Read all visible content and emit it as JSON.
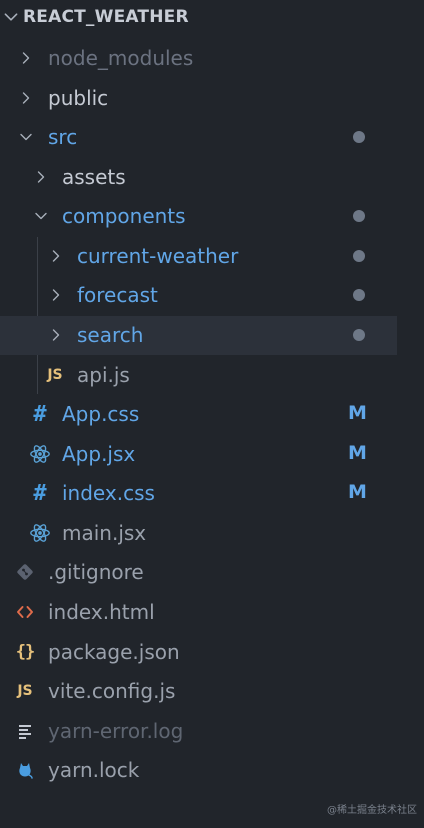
{
  "explorer": {
    "title": "REACT_WEATHER",
    "colors": {
      "background": "#21252b",
      "selected_row": "#2c313a",
      "text_default": "#c5cad3",
      "text_dimmed": "#6b7280",
      "text_modified": "#61a6e7",
      "modified_badge": "#61a6e7",
      "dot": "#6e7887",
      "chevron": "#a9b0bb",
      "js_icon": "#e5c07b",
      "css_icon": "#4a9de0",
      "react_icon": "#5aa2d6",
      "git_icon": "#5b6270",
      "html_icon": "#e06c4b",
      "json_icon": "#e5c07b",
      "log_icon": "#c5cad3",
      "yarn_icon": "#4a9de0"
    },
    "items": [
      {
        "label": "node_modules",
        "icon": "chevron-right-icon",
        "kind": "folder",
        "state": "collapsed",
        "dimmed": true
      },
      {
        "label": "public",
        "icon": "chevron-right-icon",
        "kind": "folder",
        "state": "collapsed"
      },
      {
        "label": "src",
        "icon": "chevron-down-icon",
        "kind": "folder",
        "state": "expanded",
        "modified": true,
        "has_dot": true
      },
      {
        "label": "assets",
        "icon": "chevron-right-icon",
        "kind": "folder",
        "state": "collapsed"
      },
      {
        "label": "components",
        "icon": "chevron-down-icon",
        "kind": "folder",
        "state": "expanded",
        "modified": true,
        "has_dot": true
      },
      {
        "label": "current-weather",
        "icon": "chevron-right-icon",
        "kind": "folder",
        "state": "collapsed",
        "modified": true,
        "has_dot": true
      },
      {
        "label": "forecast",
        "icon": "chevron-right-icon",
        "kind": "folder",
        "state": "collapsed",
        "modified": true,
        "has_dot": true
      },
      {
        "label": "search",
        "icon": "chevron-right-icon",
        "kind": "folder",
        "state": "collapsed",
        "modified": true,
        "has_dot": true,
        "selected": true
      },
      {
        "label": "api.js",
        "icon": "js-file-icon",
        "icon_text": "JS",
        "kind": "file"
      },
      {
        "label": "App.css",
        "icon": "css-hash-icon",
        "icon_text": "#",
        "kind": "file",
        "modified": true,
        "badge": "M"
      },
      {
        "label": "App.jsx",
        "icon": "react-atom-icon",
        "kind": "file",
        "modified": true,
        "badge": "M"
      },
      {
        "label": "index.css",
        "icon": "css-hash-icon",
        "icon_text": "#",
        "kind": "file",
        "modified": true,
        "badge": "M"
      },
      {
        "label": "main.jsx",
        "icon": "react-atom-icon",
        "kind": "file"
      },
      {
        "label": ".gitignore",
        "icon": "git-diamond-icon",
        "kind": "file"
      },
      {
        "label": "index.html",
        "icon": "html-code-icon",
        "kind": "file"
      },
      {
        "label": "package.json",
        "icon": "json-braces-icon",
        "icon_text": "{}",
        "kind": "file"
      },
      {
        "label": "vite.config.js",
        "icon": "js-file-icon",
        "icon_text": "JS",
        "kind": "file"
      },
      {
        "label": "yarn-error.log",
        "icon": "log-lines-icon",
        "kind": "file",
        "dimmed": true
      },
      {
        "label": "yarn.lock",
        "icon": "yarn-cat-icon",
        "kind": "file"
      }
    ]
  },
  "watermark": "@稀土掘金技术社区"
}
